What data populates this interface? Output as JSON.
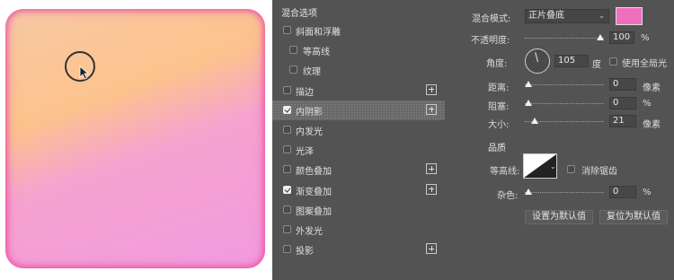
{
  "styles_panel": {
    "heading": "混合选项",
    "items": [
      {
        "label": "斜面和浮雕",
        "checked": false,
        "indent": 0,
        "plus": false,
        "active": false
      },
      {
        "label": "等高线",
        "checked": false,
        "indent": 1,
        "plus": false,
        "active": false
      },
      {
        "label": "纹理",
        "checked": false,
        "indent": 1,
        "plus": false,
        "active": false
      },
      {
        "label": "描边",
        "checked": false,
        "indent": 0,
        "plus": true,
        "active": false
      },
      {
        "label": "内阴影",
        "checked": true,
        "indent": 0,
        "plus": true,
        "active": true
      },
      {
        "label": "内发光",
        "checked": false,
        "indent": 0,
        "plus": false,
        "active": false
      },
      {
        "label": "光泽",
        "checked": false,
        "indent": 0,
        "plus": false,
        "active": false
      },
      {
        "label": "颜色叠加",
        "checked": false,
        "indent": 0,
        "plus": true,
        "active": false
      },
      {
        "label": "渐变叠加",
        "checked": true,
        "indent": 0,
        "plus": true,
        "active": false
      },
      {
        "label": "图案叠加",
        "checked": false,
        "indent": 0,
        "plus": false,
        "active": false
      },
      {
        "label": "外发光",
        "checked": false,
        "indent": 0,
        "plus": false,
        "active": false
      },
      {
        "label": "投影",
        "checked": false,
        "indent": 0,
        "plus": true,
        "active": false
      }
    ]
  },
  "options": {
    "blend_mode_label": "混合模式:",
    "blend_mode_value": "正片叠底",
    "color_swatch": "#ee6fbd",
    "opacity_label": "不透明度:",
    "opacity_value": "100",
    "opacity_unit": "%",
    "opacity_level": 1.0,
    "angle_label": "角度:",
    "angle_value": "105",
    "angle_unit": "度",
    "global_light_label": "使用全局光",
    "global_light_checked": false,
    "distance_label": "距离:",
    "distance_value": "0",
    "distance_unit": "像素",
    "distance_level": 0.0,
    "choke_label": "阻塞:",
    "choke_value": "0",
    "choke_unit": "%",
    "choke_level": 0.0,
    "size_label": "大小:",
    "size_value": "21",
    "size_unit": "像素",
    "size_level": 0.09,
    "quality_heading": "品质",
    "contour_label": "等高线:",
    "antialias_label": "消除锯齿",
    "antialias_checked": false,
    "noise_label": "杂色:",
    "noise_value": "0",
    "noise_unit": "%",
    "noise_level": 0.0,
    "make_default_label": "设置为默认值",
    "reset_default_label": "复位为默认值"
  },
  "icons": {
    "cursor": "arrow-cursor-icon",
    "add": "plus-icon",
    "dropdown": "chevron-down-icon"
  }
}
